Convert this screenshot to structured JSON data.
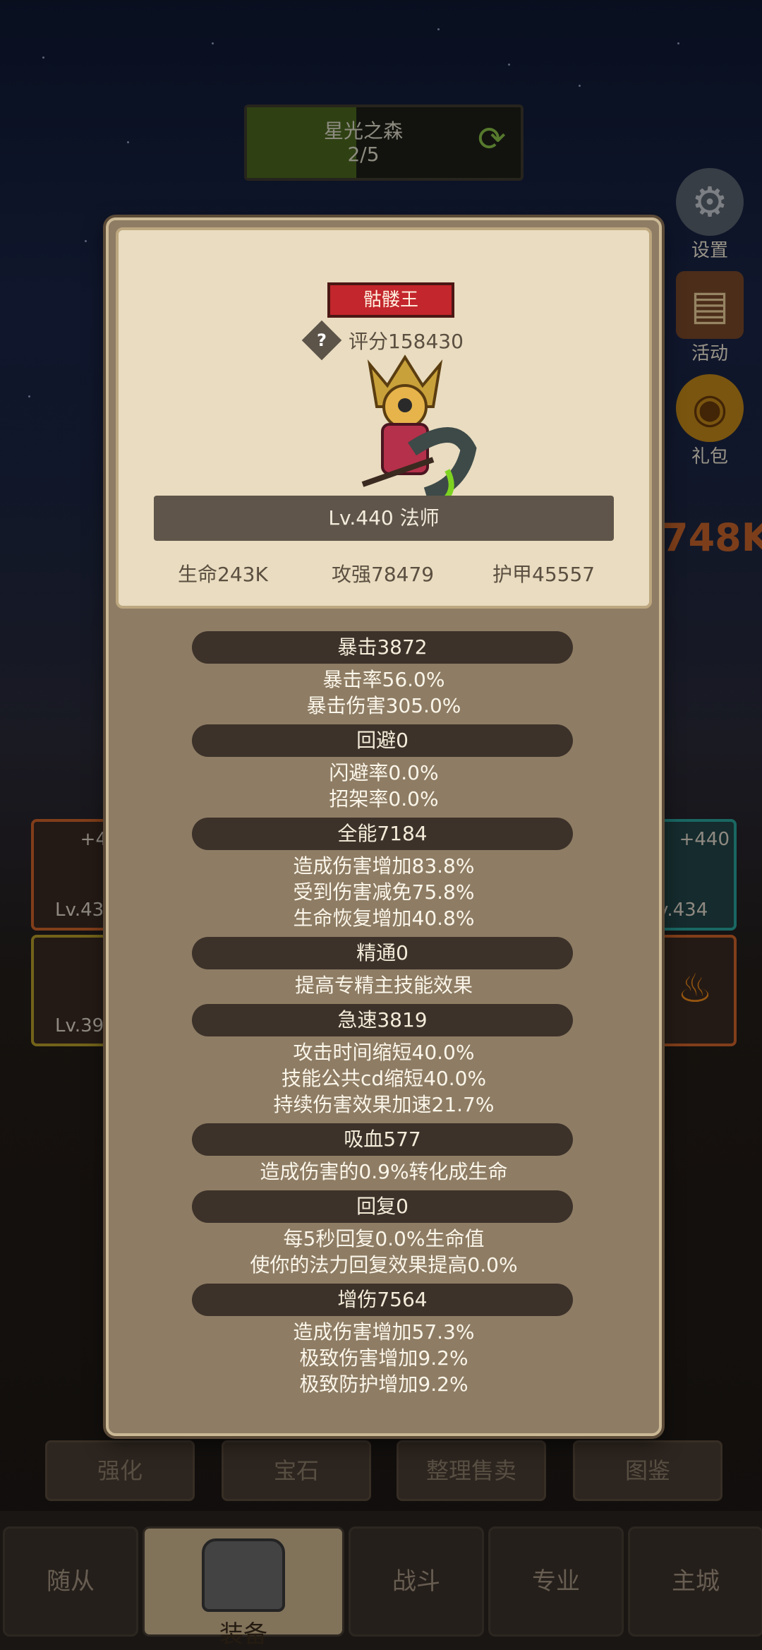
{
  "stage": {
    "name": "星光之森",
    "progress": "2/5",
    "fill_fraction": 0.4
  },
  "side_menu": [
    {
      "label": "设置",
      "icon": "gear-icon"
    },
    {
      "label": "活动",
      "icon": "calendar-icon"
    },
    {
      "label": "礼包",
      "icon": "gift-pot-icon"
    }
  ],
  "background": {
    "damage_number": "748K",
    "slot_left_top_plus": "+4",
    "slot_left_top_level": "Lv.43",
    "slot_left_bottom_level": "Lv.39",
    "slot_right_top_plus": "+440",
    "slot_right_top_level": "v.434"
  },
  "controls": [
    "强化",
    "宝石",
    "整理售卖",
    "图鉴"
  ],
  "tabs": [
    "随从",
    "装备",
    "战斗",
    "专业",
    "主城"
  ],
  "active_tab": "装备",
  "modal": {
    "name": "骷髅王",
    "score": "评分158430",
    "level_class": "Lv.440 法师",
    "stats": {
      "hp": "生命243K",
      "attack": "攻强78479",
      "armor": "护甲45557"
    },
    "sections": [
      {
        "title": "暴击3872",
        "lines": [
          "暴击率56.0%",
          "暴击伤害305.0%"
        ]
      },
      {
        "title": "回避0",
        "lines": [
          "闪避率0.0%",
          "招架率0.0%"
        ]
      },
      {
        "title": "全能7184",
        "lines": [
          "造成伤害增加83.8%",
          "受到伤害减免75.8%",
          "生命恢复增加40.8%"
        ]
      },
      {
        "title": "精通0",
        "lines": [
          "提高专精主技能效果"
        ]
      },
      {
        "title": "急速3819",
        "lines": [
          "攻击时间缩短40.0%",
          "技能公共cd缩短40.0%",
          "持续伤害效果加速21.7%"
        ]
      },
      {
        "title": "吸血577",
        "lines": [
          "造成伤害的0.9%转化成生命"
        ]
      },
      {
        "title": "回复0",
        "lines": [
          "每5秒回复0.0%生命值",
          "使你的法力回复效果提高0.0%"
        ]
      },
      {
        "title": "增伤7564",
        "lines": [
          "造成伤害增加57.3%",
          "极致伤害增加9.2%",
          "极致防护增加9.2%"
        ]
      }
    ]
  }
}
